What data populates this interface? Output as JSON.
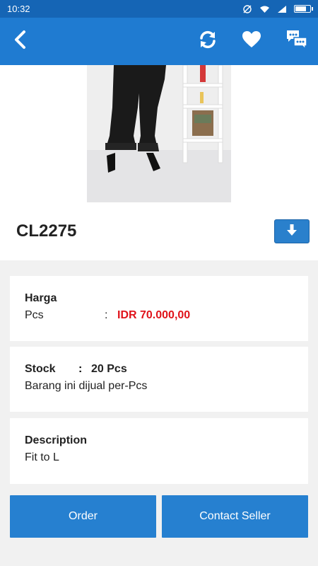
{
  "status_bar": {
    "time": "10:32"
  },
  "app_bar": {
    "back_icon": "chevron-left-icon",
    "refresh_icon": "refresh-icon",
    "favorite_icon": "heart-icon",
    "chat_icon": "chat-bubbles-icon"
  },
  "product": {
    "code": "CL2275"
  },
  "price": {
    "label": "Harga",
    "unit": "Pcs",
    "colon": ":",
    "value": "IDR 70.000,00"
  },
  "stock": {
    "label": "Stock",
    "colon": ":",
    "value": "20 Pcs",
    "note": "Barang ini dijual per-Pcs"
  },
  "description": {
    "label": "Description",
    "text": "Fit to L"
  },
  "actions": {
    "order_label": "Order",
    "contact_label": "Contact Seller"
  },
  "colors": {
    "app_bar": "#1f7bd1",
    "status_bar": "#1565b5",
    "button": "#2680d0",
    "price": "#e0141b"
  }
}
